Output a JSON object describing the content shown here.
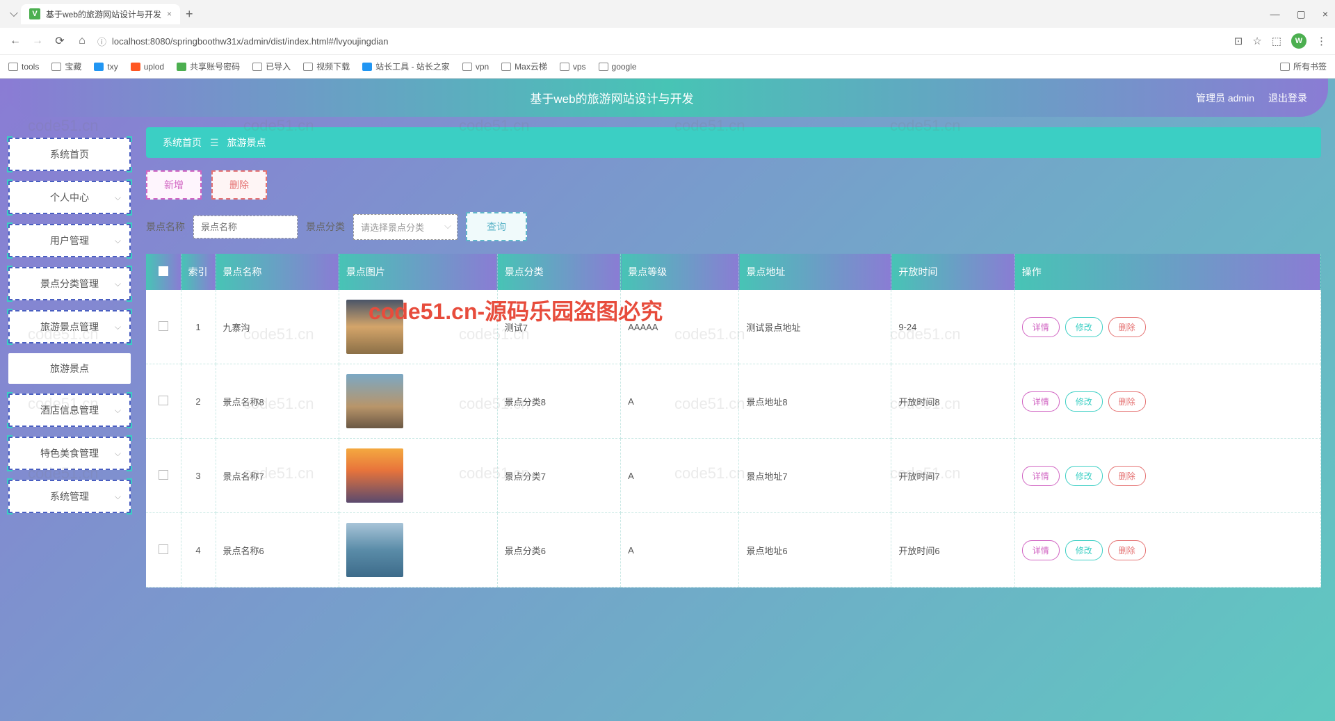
{
  "browser": {
    "tab_title": "基于web的旅游网站设计与开发",
    "url": "localhost:8080/springboothw31x/admin/dist/index.html#/lvyoujingdian",
    "bookmarks": [
      "tools",
      "宝藏",
      "txy",
      "uplod",
      "共享账号密码",
      "已导入",
      "视频下载",
      "站长工具 - 站长之家",
      "vpn",
      "Max云梯",
      "vps",
      "google"
    ],
    "all_bookmarks": "所有书签",
    "avatar": "W"
  },
  "header": {
    "title": "基于web的旅游网站设计与开发",
    "user_role": "管理员",
    "user_name": "admin",
    "logout": "退出登录"
  },
  "sidebar": {
    "items": [
      {
        "label": "系统首页",
        "exp": false
      },
      {
        "label": "个人中心",
        "exp": true
      },
      {
        "label": "用户管理",
        "exp": true
      },
      {
        "label": "景点分类管理",
        "exp": true
      },
      {
        "label": "旅游景点管理",
        "exp": true
      },
      {
        "label": "旅游景点",
        "exp": false,
        "active": true
      },
      {
        "label": "酒店信息管理",
        "exp": true
      },
      {
        "label": "特色美食管理",
        "exp": true
      },
      {
        "label": "系统管理",
        "exp": true
      }
    ]
  },
  "breadcrumb": {
    "home": "系统首页",
    "current": "旅游景点"
  },
  "actions": {
    "add": "新增",
    "delete": "删除",
    "query": "查询"
  },
  "filters": {
    "name_label": "景点名称",
    "name_placeholder": "景点名称",
    "cat_label": "景点分类",
    "cat_placeholder": "请选择景点分类"
  },
  "table": {
    "headers": [
      "索引",
      "景点名称",
      "景点图片",
      "景点分类",
      "景点等级",
      "景点地址",
      "开放时间",
      "操作"
    ],
    "ops": {
      "detail": "详情",
      "modify": "修改",
      "delete": "删除"
    },
    "rows": [
      {
        "idx": "1",
        "name": "九寨沟",
        "cat": "测试7",
        "grade": "AAAAA",
        "addr": "测试景点地址",
        "time": "9-24"
      },
      {
        "idx": "2",
        "name": "景点名称8",
        "cat": "景点分类8",
        "grade": "A",
        "addr": "景点地址8",
        "time": "开放时间8"
      },
      {
        "idx": "3",
        "name": "景点名称7",
        "cat": "景点分类7",
        "grade": "A",
        "addr": "景点地址7",
        "time": "开放时间7"
      },
      {
        "idx": "4",
        "name": "景点名称6",
        "cat": "景点分类6",
        "grade": "A",
        "addr": "景点地址6",
        "time": "开放时间6"
      }
    ]
  },
  "watermark": "code51.cn",
  "watermark_red": "code51.cn-源码乐园盗图必究"
}
